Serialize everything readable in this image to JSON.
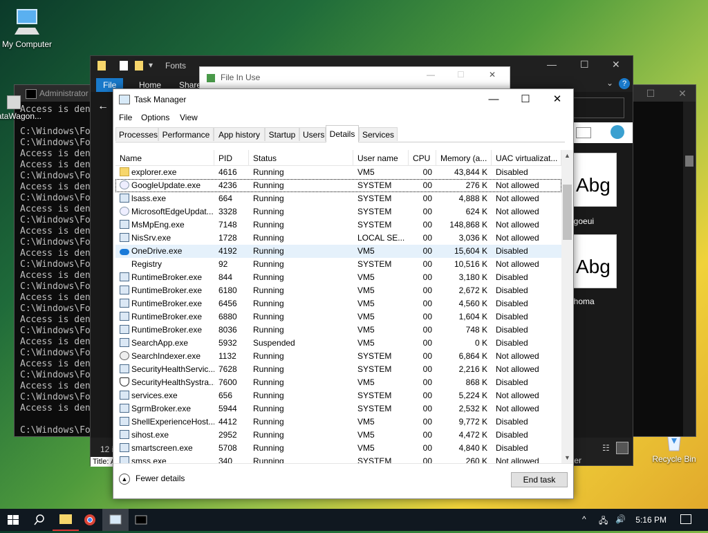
{
  "desktop": {
    "icons": [
      {
        "label": "My Computer"
      },
      {
        "label": "DataWagon..."
      },
      {
        "label": "Recycle Bin"
      }
    ]
  },
  "console": {
    "title": "Administrator",
    "lines": [
      "Access is den",
      "",
      "C:\\Windows\\Fo",
      "C:\\Windows\\Fo",
      "Access is den",
      "Access is den",
      "C:\\Windows\\Fo",
      "Access is den",
      "C:\\Windows\\Fo",
      "Access is den",
      "C:\\Windows\\Fo",
      "Access is den",
      "C:\\Windows\\Fo",
      "Access is den",
      "C:\\Windows\\Fo",
      "Access is den",
      "C:\\Windows\\Fo",
      "Access is den",
      "C:\\Windows\\Fo",
      "Access is den",
      "C:\\Windows\\Fo",
      "Access is den",
      "C:\\Windows\\Fo",
      "Access is den",
      "C:\\Windows\\Fo",
      "Access is den",
      "C:\\Windows\\Fo",
      "Access is den",
      "",
      "C:\\Windows\\Fo"
    ]
  },
  "explorer": {
    "title": "Fonts",
    "ribbon_tabs": [
      "File",
      "Home",
      "Share"
    ],
    "files": [
      {
        "thumb": "Abg",
        "name": "egoeui"
      },
      {
        "thumb": "Abg",
        "name": "ahoma"
      }
    ],
    "status_left": "12 i",
    "status_right": "ter",
    "title_partial": "Title: A"
  },
  "file_in_use": {
    "title": "File In Use"
  },
  "task_manager": {
    "title": "Task Manager",
    "menu": [
      "File",
      "Options",
      "View"
    ],
    "tabs": [
      "Processes",
      "Performance",
      "App history",
      "Startup",
      "Users",
      "Details",
      "Services"
    ],
    "active_tab": "Details",
    "columns": [
      "Name",
      "PID",
      "Status",
      "User name",
      "CPU",
      "Memory (a...",
      "UAC virtualizat..."
    ],
    "rows": [
      {
        "icon": "folder-icon",
        "name": "explorer.exe",
        "pid": "4616",
        "status": "Running",
        "user": "VM5",
        "cpu": "00",
        "memory": "43,844 K",
        "uac": "Disabled"
      },
      {
        "icon": "app-icon",
        "name": "GoogleUpdate.exe",
        "pid": "4236",
        "status": "Running",
        "user": "SYSTEM",
        "cpu": "00",
        "memory": "276 K",
        "uac": "Not allowed"
      },
      {
        "icon": "window-icon",
        "name": "lsass.exe",
        "pid": "664",
        "status": "Running",
        "user": "SYSTEM",
        "cpu": "00",
        "memory": "4,888 K",
        "uac": "Not allowed"
      },
      {
        "icon": "app-icon",
        "name": "MicrosoftEdgeUpdat...",
        "pid": "3328",
        "status": "Running",
        "user": "SYSTEM",
        "cpu": "00",
        "memory": "624 K",
        "uac": "Not allowed"
      },
      {
        "icon": "window-icon",
        "name": "MsMpEng.exe",
        "pid": "7148",
        "status": "Running",
        "user": "SYSTEM",
        "cpu": "00",
        "memory": "148,868 K",
        "uac": "Not allowed"
      },
      {
        "icon": "window-icon",
        "name": "NisSrv.exe",
        "pid": "1728",
        "status": "Running",
        "user": "LOCAL SE...",
        "cpu": "00",
        "memory": "3,036 K",
        "uac": "Not allowed"
      },
      {
        "icon": "cloud-icon",
        "name": "OneDrive.exe",
        "pid": "4192",
        "status": "Running",
        "user": "VM5",
        "cpu": "00",
        "memory": "15,604 K",
        "uac": "Disabled"
      },
      {
        "icon": "none",
        "name": "Registry",
        "pid": "92",
        "status": "Running",
        "user": "SYSTEM",
        "cpu": "00",
        "memory": "10,516 K",
        "uac": "Not allowed"
      },
      {
        "icon": "window-icon",
        "name": "RuntimeBroker.exe",
        "pid": "844",
        "status": "Running",
        "user": "VM5",
        "cpu": "00",
        "memory": "3,180 K",
        "uac": "Disabled"
      },
      {
        "icon": "window-icon",
        "name": "RuntimeBroker.exe",
        "pid": "6180",
        "status": "Running",
        "user": "VM5",
        "cpu": "00",
        "memory": "2,672 K",
        "uac": "Disabled"
      },
      {
        "icon": "window-icon",
        "name": "RuntimeBroker.exe",
        "pid": "6456",
        "status": "Running",
        "user": "VM5",
        "cpu": "00",
        "memory": "4,560 K",
        "uac": "Disabled"
      },
      {
        "icon": "window-icon",
        "name": "RuntimeBroker.exe",
        "pid": "6880",
        "status": "Running",
        "user": "VM5",
        "cpu": "00",
        "memory": "1,604 K",
        "uac": "Disabled"
      },
      {
        "icon": "window-icon",
        "name": "RuntimeBroker.exe",
        "pid": "8036",
        "status": "Running",
        "user": "VM5",
        "cpu": "00",
        "memory": "748 K",
        "uac": "Disabled"
      },
      {
        "icon": "window-icon",
        "name": "SearchApp.exe",
        "pid": "5932",
        "status": "Suspended",
        "user": "VM5",
        "cpu": "00",
        "memory": "0 K",
        "uac": "Disabled"
      },
      {
        "icon": "user-icon",
        "name": "SearchIndexer.exe",
        "pid": "1132",
        "status": "Running",
        "user": "SYSTEM",
        "cpu": "00",
        "memory": "6,864 K",
        "uac": "Not allowed"
      },
      {
        "icon": "window-icon",
        "name": "SecurityHealthServic...",
        "pid": "7628",
        "status": "Running",
        "user": "SYSTEM",
        "cpu": "00",
        "memory": "2,216 K",
        "uac": "Not allowed"
      },
      {
        "icon": "shield-icon",
        "name": "SecurityHealthSystra...",
        "pid": "7600",
        "status": "Running",
        "user": "VM5",
        "cpu": "00",
        "memory": "868 K",
        "uac": "Disabled"
      },
      {
        "icon": "window-icon",
        "name": "services.exe",
        "pid": "656",
        "status": "Running",
        "user": "SYSTEM",
        "cpu": "00",
        "memory": "5,224 K",
        "uac": "Not allowed"
      },
      {
        "icon": "window-icon",
        "name": "SgrmBroker.exe",
        "pid": "5944",
        "status": "Running",
        "user": "SYSTEM",
        "cpu": "00",
        "memory": "2,532 K",
        "uac": "Not allowed"
      },
      {
        "icon": "window-icon",
        "name": "ShellExperienceHost....",
        "pid": "4412",
        "status": "Running",
        "user": "VM5",
        "cpu": "00",
        "memory": "9,772 K",
        "uac": "Disabled"
      },
      {
        "icon": "window-icon",
        "name": "sihost.exe",
        "pid": "2952",
        "status": "Running",
        "user": "VM5",
        "cpu": "00",
        "memory": "4,472 K",
        "uac": "Disabled"
      },
      {
        "icon": "window-icon",
        "name": "smartscreen.exe",
        "pid": "5708",
        "status": "Running",
        "user": "VM5",
        "cpu": "00",
        "memory": "4,840 K",
        "uac": "Disabled"
      },
      {
        "icon": "window-icon",
        "name": "smss.exe",
        "pid": "340",
        "status": "Running",
        "user": "SYSTEM",
        "cpu": "00",
        "memory": "260 K",
        "uac": "Not allowed"
      }
    ],
    "selected_row": 1,
    "hover_row": 6,
    "fewer_details": "Fewer details",
    "end_task": "End task"
  },
  "taskbar": {
    "time": "5:16 PM"
  },
  "colors": {
    "accent": "#1979ca",
    "console_bg": "#0c0c0c",
    "taskbar_bg": "#101820"
  }
}
